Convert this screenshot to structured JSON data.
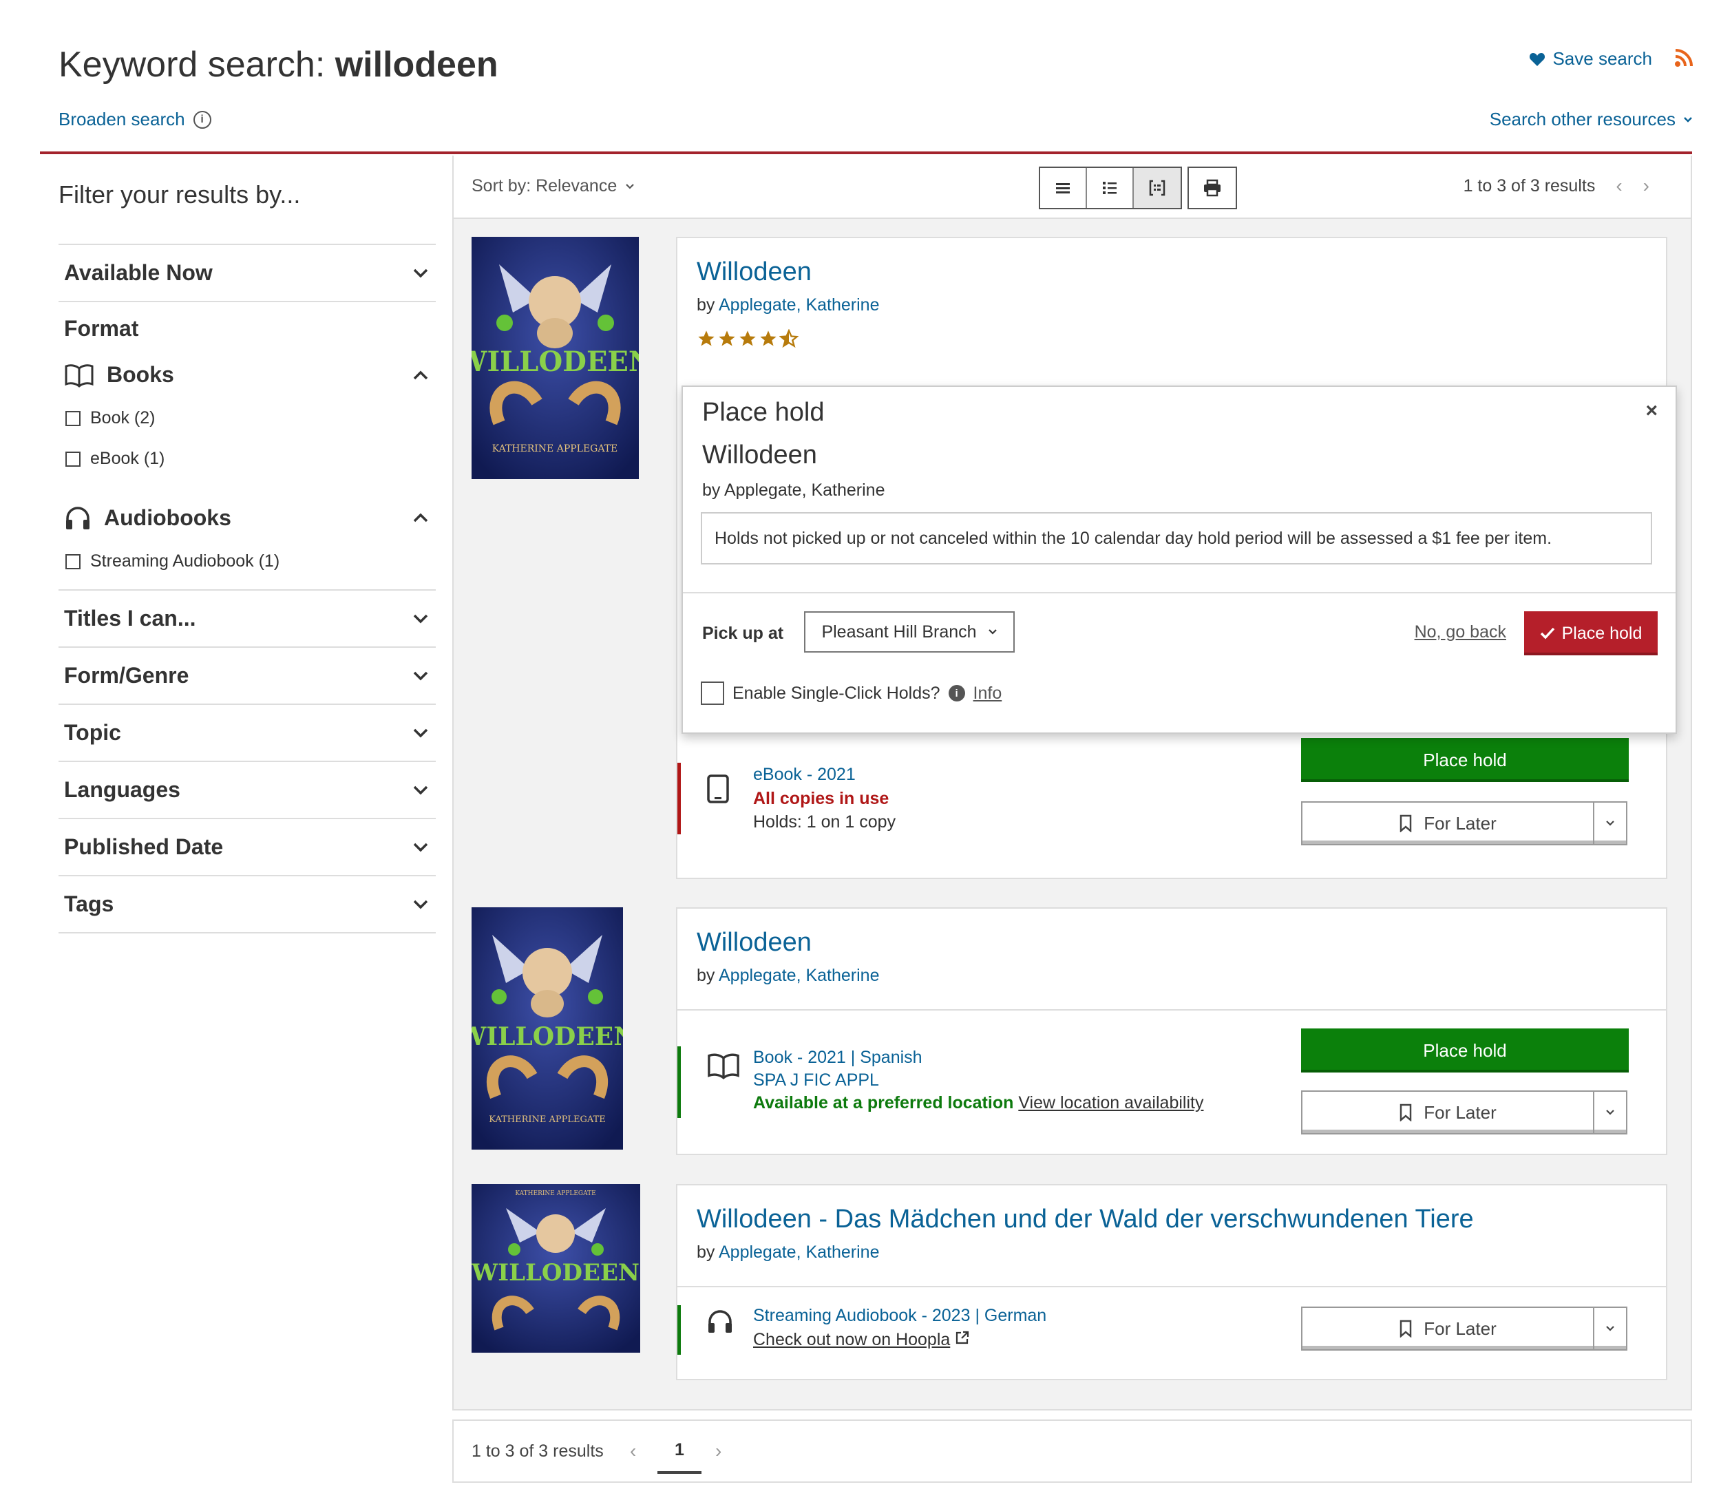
{
  "header": {
    "title_prefix": "Keyword search: ",
    "title_term": "willodeen",
    "broaden_search": "Broaden search",
    "save_search": "Save search",
    "search_other": "Search other resources"
  },
  "sidebar": {
    "filter_title": "Filter your results by...",
    "available_now": "Available Now",
    "format_title": "Format",
    "books_label": "Books",
    "book_option": "Book (2)",
    "ebook_option": "eBook (1)",
    "audiobooks_label": "Audiobooks",
    "streaming_option": "Streaming Audiobook (1)",
    "facets": [
      "Titles I can...",
      "Form/Genre",
      "Topic",
      "Languages",
      "Published Date",
      "Tags"
    ]
  },
  "toolbar": {
    "sort": "Sort by: Relevance",
    "results_count": "1 to 3 of 3 results"
  },
  "results": [
    {
      "title": "Willodeen",
      "by_prefix": "by ",
      "author": "Applegate, Katherine",
      "rating_stars": 4.5,
      "format": "eBook - 2021",
      "status": "All copies in use",
      "holds": "Holds: 1 on 1 copy",
      "place_hold": "Place hold",
      "for_later": "For Later"
    },
    {
      "title": "Willodeen",
      "by_prefix": "by ",
      "author": "Applegate, Katherine",
      "format": "Book - 2021",
      "language": "Spanish",
      "call_number": "SPA J FIC APPL",
      "status": "Available at a preferred location",
      "availability_link": "View location availability",
      "place_hold": "Place hold",
      "for_later": "For Later"
    },
    {
      "title": "Willodeen - Das Mädchen und der Wald der verschwundenen Tiere",
      "by_prefix": "by ",
      "author": "Applegate, Katherine",
      "format": "Streaming Audiobook - 2023",
      "language": "German",
      "checkout_link": "Check out now on Hoopla",
      "for_later": "For Later"
    }
  ],
  "hold_popup": {
    "title": "Place hold",
    "close": "×",
    "book_title": "Willodeen",
    "byline": "by Applegate, Katherine",
    "notice": "Holds not picked up or not canceled within the 10 calendar day hold period will be assessed a $1 fee per item.",
    "pick_up_label": "Pick up at",
    "branch": "Pleasant Hill Branch",
    "go_back": "No, go back",
    "place_hold": "Place hold",
    "single_click": "Enable Single-Click Holds?",
    "info": "Info"
  },
  "pager": {
    "results_count": "1 to 3 of 3 results",
    "current_page": "1"
  },
  "colors": {
    "link": "#0a6296",
    "accent_red": "#a3232c",
    "place_hold_green": "#0b800b",
    "place_hold_red": "#b51f2a",
    "available_green": "#0d7a0d",
    "unavailable_red": "#b01717"
  },
  "covers": [
    {
      "text_title": "WILLODEEN",
      "text_author": "KATHERINE APPLEGATE"
    },
    {
      "text_title": "WILLODEEN",
      "text_author": "KATHERINE APPLEGATE"
    },
    {
      "text_title": "WILLODEEN",
      "text_author": "KATHERINE APPLEGATE"
    }
  ]
}
